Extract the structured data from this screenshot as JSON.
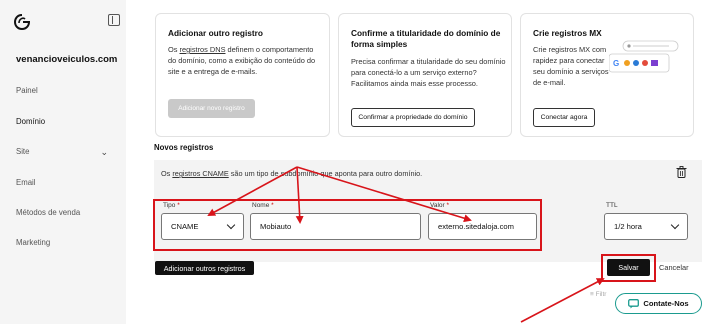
{
  "sidebar": {
    "site_name": "venancioveiculos.com",
    "items": [
      {
        "label": "Painel"
      },
      {
        "label": "Domínio"
      },
      {
        "label": "Site"
      },
      {
        "label": "Email"
      },
      {
        "label": "Métodos de venda"
      },
      {
        "label": "Marketing"
      }
    ]
  },
  "cards": {
    "add": {
      "title": "Adicionar outro registro",
      "text_before": "Os ",
      "link": "registros DNS",
      "text_after": " definem o comportamento do domínio, como a exibição do conteúdo do site e a entrega de e-mails.",
      "button": "Adicionar novo registro"
    },
    "confirm": {
      "title": "Confirme a titularidade do domínio de forma simples",
      "text": "Precisa confirmar a titularidade do seu domínio para conectá-lo a um serviço externo? Facilitamos ainda mais esse processo.",
      "button": "Confirmar a propriedade do domínio"
    },
    "mx": {
      "title": "Crie registros MX",
      "text": "Crie registros MX com rapidez para conectar seu domínio a serviços de e-mail.",
      "button": "Conectar agora"
    }
  },
  "records": {
    "title": "Novos registros",
    "info_before": "Os ",
    "info_link": "registros CNAME",
    "info_after": " são um tipo de subdomínio que aponta para outro domínio.",
    "fields": {
      "type": {
        "label": "Tipo",
        "value": "CNAME"
      },
      "name": {
        "label": "Nome",
        "value": "Mobiauto"
      },
      "value": {
        "label": "Valor",
        "value": "externo.sitedaloja.com"
      },
      "ttl": {
        "label": "TTL",
        "value": "1/2 hora"
      }
    },
    "required_mark": "*",
    "add_more": "Adicionar outros registros",
    "save": "Salvar",
    "cancel": "Cancelar",
    "filter_hint": "Filtr"
  },
  "contact": {
    "label": "Contate-Nos"
  },
  "colors": {
    "annotation": "#d8141a",
    "accent": "#1b9b8f"
  }
}
